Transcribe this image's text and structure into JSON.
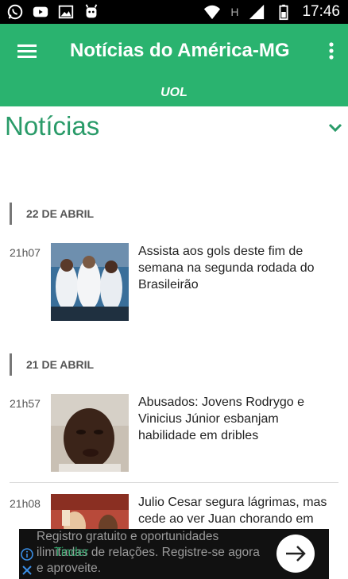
{
  "status_bar": {
    "time": "17:46",
    "network": "H",
    "icons": [
      "whatsapp-icon",
      "youtube-icon",
      "image-icon",
      "android-icon",
      "wifi-icon",
      "signal-icon",
      "battery-icon"
    ]
  },
  "app_bar": {
    "title": "Notícias do América-MG",
    "icons": [
      "menu-icon",
      "more-vert-icon"
    ]
  },
  "source_bar": {
    "label": "UOL"
  },
  "section": {
    "title": "Notícias",
    "icon": "chevron-down-icon"
  },
  "colors": {
    "primary": "#2ab36f",
    "section_title": "#2a9b69"
  },
  "news_groups": [
    {
      "date": "22 DE ABRIL",
      "items": [
        {
          "time": "21h07",
          "headline": "Assista aos gols deste fim de semana na segunda rodada do Brasileirão"
        }
      ]
    },
    {
      "date": "21 DE ABRIL",
      "items": [
        {
          "time": "21h57",
          "headline": "Abusados: Jovens Rodrygo e Vinicius Júnior esbanjam habilidade em dribles"
        },
        {
          "time": "21h08",
          "headline": "Julio Cesar segura lágrimas, mas cede ao ver Juan chorando em"
        }
      ]
    }
  ],
  "ad": {
    "text_line1": "Registro gratuito e oportunidades",
    "text_line2": "ilimitadas de relações. Registre-se agora",
    "text_line3": "e aproveite.",
    "sponsor": "Tinder",
    "icons": [
      "info-icon",
      "close-icon",
      "arrow-right-icon"
    ]
  }
}
